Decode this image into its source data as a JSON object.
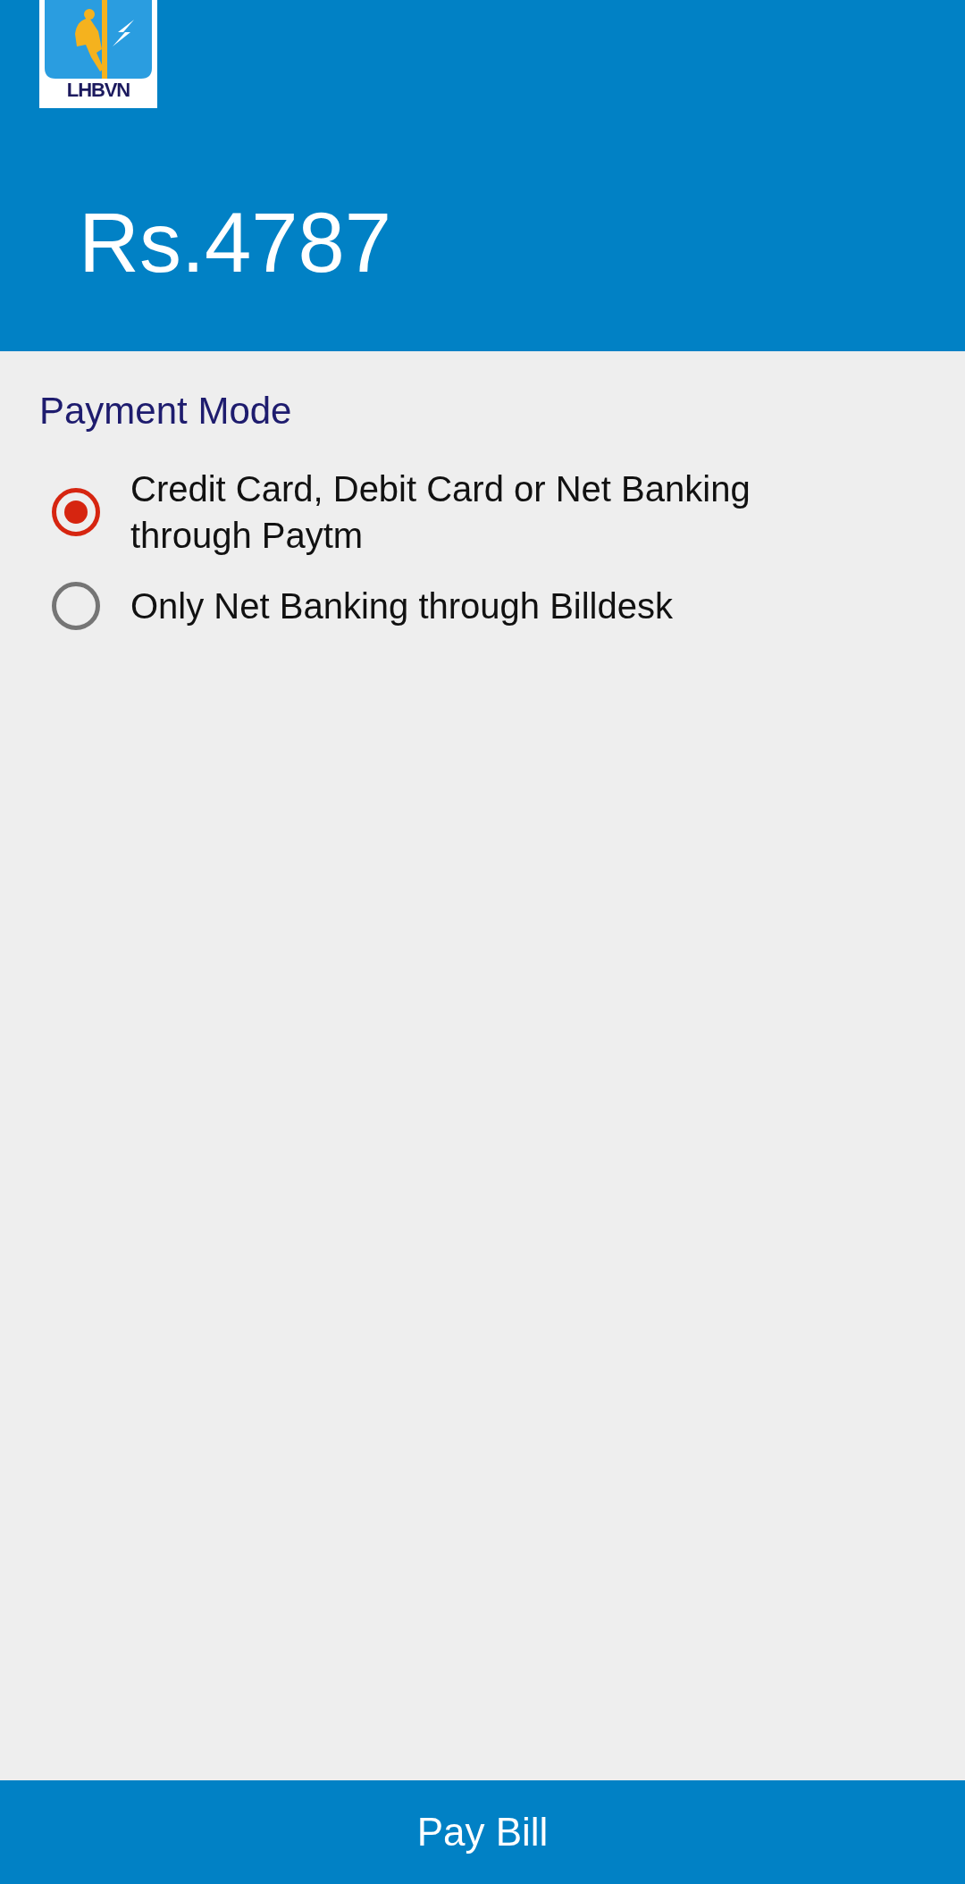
{
  "header": {
    "logo_text": "LHBVN",
    "amount": "Rs.4787"
  },
  "payment_mode": {
    "title": "Payment Mode",
    "options": [
      {
        "label": "Credit Card, Debit Card or Net Banking through Paytm",
        "selected": true
      },
      {
        "label": "Only Net Banking through Billdesk",
        "selected": false
      }
    ]
  },
  "footer_button": "Pay Bill"
}
